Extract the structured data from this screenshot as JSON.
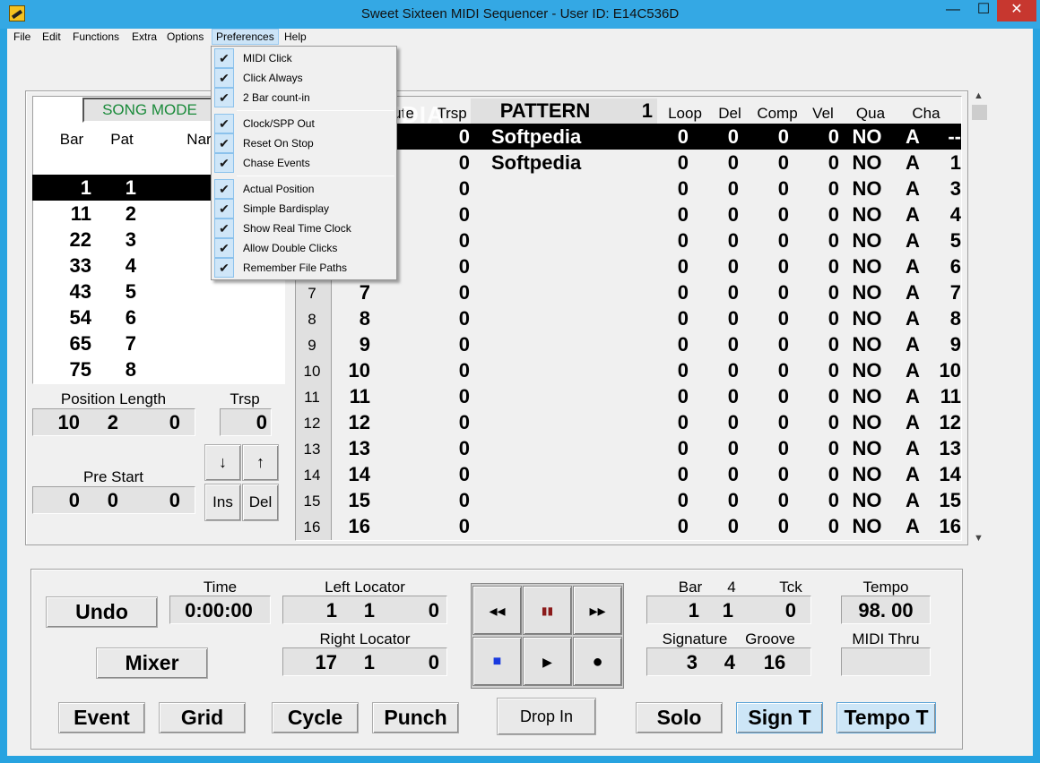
{
  "window": {
    "title": "Sweet Sixteen MIDI Sequencer - User ID: E14C536D",
    "minimize": "—",
    "maximize": "☐",
    "close": "✕"
  },
  "menubar": [
    "File",
    "Edit",
    "Functions",
    "Extra",
    "Options",
    "Preferences",
    "Help"
  ],
  "preferences_menu": {
    "group1": [
      {
        "label": "MIDI Click",
        "checked": true
      },
      {
        "label": "Click Always",
        "checked": true
      },
      {
        "label": "2 Bar count-in",
        "checked": true
      }
    ],
    "group2": [
      {
        "label": "Clock/SPP Out",
        "checked": true
      },
      {
        "label": "Reset On Stop",
        "checked": true
      },
      {
        "label": "Chase Events",
        "checked": true
      }
    ],
    "group3": [
      {
        "label": "Actual Position",
        "checked": true
      },
      {
        "label": "Simple Bardisplay",
        "checked": true
      },
      {
        "label": "Show Real Time Clock",
        "checked": true
      },
      {
        "label": "Allow Double Clicks",
        "checked": true
      },
      {
        "label": "Remember File Paths",
        "checked": true
      }
    ]
  },
  "song": {
    "mode_label": "SONG MODE",
    "headers": {
      "bar": "Bar",
      "pat": "Pat",
      "name": "Nar"
    },
    "rows": [
      {
        "bar": "1",
        "pat": "1",
        "selected": true
      },
      {
        "bar": "11",
        "pat": "2"
      },
      {
        "bar": "22",
        "pat": "3"
      },
      {
        "bar": "33",
        "pat": "4"
      },
      {
        "bar": "43",
        "pat": "5"
      },
      {
        "bar": "54",
        "pat": "6"
      },
      {
        "bar": "65",
        "pat": "7"
      },
      {
        "bar": "75",
        "pat": "8"
      }
    ],
    "position_length_label": "Position Length",
    "trsp_label": "Trsp",
    "position": {
      "bar": "10",
      "beat": "2",
      "tick": "0"
    },
    "trsp": "0",
    "pre_start_label": "Pre Start",
    "pre_start": {
      "bar": "0",
      "beat": "0",
      "tick": "0"
    },
    "buttons": {
      "down": "↓",
      "up": "↑",
      "ins": "Ins",
      "del": "Del"
    }
  },
  "pattern": {
    "headers": {
      "mute": "ute",
      "trsp": "Trsp",
      "pattern": "PATTERN",
      "num": "1",
      "loop": "Loop",
      "del": "Del",
      "comp": "Comp",
      "vel": "Vel",
      "qua": "Qua",
      "cha": "Cha"
    },
    "rows": [
      {
        "idx": "",
        "id": "",
        "trsp": "0",
        "name": "Softpedia",
        "loop": "0",
        "del": "0",
        "comp": "0",
        "vel": "0",
        "qua": "NO",
        "a": "A",
        "cha": "--",
        "selected": true
      },
      {
        "idx": "",
        "id": "",
        "trsp": "0",
        "name": "Softpedia",
        "loop": "0",
        "del": "0",
        "comp": "0",
        "vel": "0",
        "qua": "NO",
        "a": "A",
        "cha": "1"
      },
      {
        "idx": "",
        "id": "",
        "trsp": "0",
        "name": "",
        "loop": "0",
        "del": "0",
        "comp": "0",
        "vel": "0",
        "qua": "NO",
        "a": "A",
        "cha": "3"
      },
      {
        "idx": "",
        "id": "",
        "trsp": "0",
        "name": "",
        "loop": "0",
        "del": "0",
        "comp": "0",
        "vel": "0",
        "qua": "NO",
        "a": "A",
        "cha": "4"
      },
      {
        "idx": "",
        "id": "",
        "trsp": "0",
        "name": "",
        "loop": "0",
        "del": "0",
        "comp": "0",
        "vel": "0",
        "qua": "NO",
        "a": "A",
        "cha": "5"
      },
      {
        "idx": "",
        "id": "",
        "trsp": "0",
        "name": "",
        "loop": "0",
        "del": "0",
        "comp": "0",
        "vel": "0",
        "qua": "NO",
        "a": "A",
        "cha": "6"
      },
      {
        "idx": "7",
        "id": "7",
        "trsp": "0",
        "name": "",
        "loop": "0",
        "del": "0",
        "comp": "0",
        "vel": "0",
        "qua": "NO",
        "a": "A",
        "cha": "7"
      },
      {
        "idx": "8",
        "id": "8",
        "trsp": "0",
        "name": "",
        "loop": "0",
        "del": "0",
        "comp": "0",
        "vel": "0",
        "qua": "NO",
        "a": "A",
        "cha": "8"
      },
      {
        "idx": "9",
        "id": "9",
        "trsp": "0",
        "name": "",
        "loop": "0",
        "del": "0",
        "comp": "0",
        "vel": "0",
        "qua": "NO",
        "a": "A",
        "cha": "9"
      },
      {
        "idx": "10",
        "id": "10",
        "trsp": "0",
        "name": "",
        "loop": "0",
        "del": "0",
        "comp": "0",
        "vel": "0",
        "qua": "NO",
        "a": "A",
        "cha": "10"
      },
      {
        "idx": "11",
        "id": "11",
        "trsp": "0",
        "name": "",
        "loop": "0",
        "del": "0",
        "comp": "0",
        "vel": "0",
        "qua": "NO",
        "a": "A",
        "cha": "11"
      },
      {
        "idx": "12",
        "id": "12",
        "trsp": "0",
        "name": "",
        "loop": "0",
        "del": "0",
        "comp": "0",
        "vel": "0",
        "qua": "NO",
        "a": "A",
        "cha": "12"
      },
      {
        "idx": "13",
        "id": "13",
        "trsp": "0",
        "name": "",
        "loop": "0",
        "del": "0",
        "comp": "0",
        "vel": "0",
        "qua": "NO",
        "a": "A",
        "cha": "13"
      },
      {
        "idx": "14",
        "id": "14",
        "trsp": "0",
        "name": "",
        "loop": "0",
        "del": "0",
        "comp": "0",
        "vel": "0",
        "qua": "NO",
        "a": "A",
        "cha": "14"
      },
      {
        "idx": "15",
        "id": "15",
        "trsp": "0",
        "name": "",
        "loop": "0",
        "del": "0",
        "comp": "0",
        "vel": "0",
        "qua": "NO",
        "a": "A",
        "cha": "15"
      },
      {
        "idx": "16",
        "id": "16",
        "trsp": "0",
        "name": "",
        "loop": "0",
        "del": "0",
        "comp": "0",
        "vel": "0",
        "qua": "NO",
        "a": "A",
        "cha": "16"
      }
    ]
  },
  "transport": {
    "undo": "Undo",
    "mixer": "Mixer",
    "time_label": "Time",
    "time": "0:00:00",
    "left_locator_label": "Left Locator",
    "left_locator": {
      "bar": "1",
      "beat": "1",
      "tick": "0"
    },
    "right_locator_label": "Right Locator",
    "right_locator": {
      "bar": "17",
      "beat": "1",
      "tick": "0"
    },
    "rewind": "◂◂",
    "pause": "▮▮",
    "ffwd": "▸▸",
    "stop": "■",
    "play": "▶",
    "record": "●",
    "bar_label": "Bar",
    "bar_beats": "4",
    "tck_label": "Tck",
    "position": {
      "bar": "1",
      "beat": "1",
      "tick": "0"
    },
    "signature_label": "Signature",
    "groove_label": "Groove",
    "signature": {
      "num": "3",
      "den": "4",
      "groove": "16"
    },
    "tempo_label": "Tempo",
    "tempo": "98. 00",
    "midi_thru_label": "MIDI Thru",
    "midi_thru": "",
    "event": "Event",
    "grid": "Grid",
    "cycle": "Cycle",
    "punch": "Punch",
    "drop_in": "Drop In",
    "solo": "Solo",
    "sign_t": "Sign T",
    "tempo_t": "Tempo T"
  },
  "watermark": "SOFTPEDIA",
  "colors": {
    "accent": "#28a3e0",
    "song_mode": "#1a8a3a",
    "selected": "#000000",
    "pause": "#8b1a1a",
    "stop": "#1a3adf",
    "toggle_on": "#cde6f7"
  }
}
